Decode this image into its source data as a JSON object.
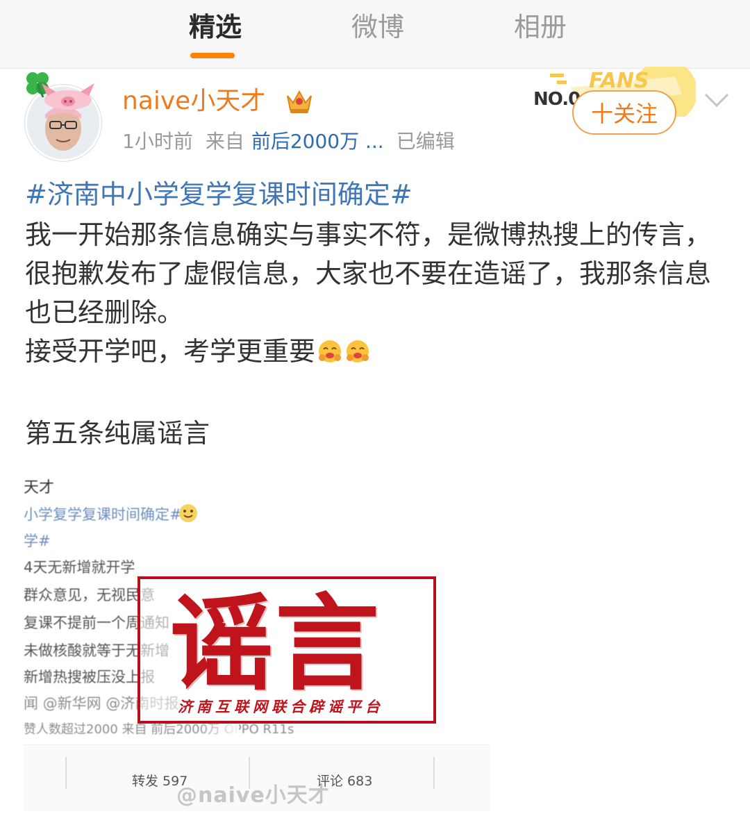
{
  "tabs": [
    {
      "label": "精选",
      "active": true
    },
    {
      "label": "微博",
      "active": false
    },
    {
      "label": "相册",
      "active": false
    }
  ],
  "colors": {
    "accent": "#ff8200",
    "username": "#f07a1a",
    "link": "#3f76b8",
    "stamp": "#c0141c"
  },
  "post": {
    "username": "naive小天才",
    "time": "1小时前",
    "from_prefix": "来自",
    "source": "前后2000万 ...",
    "edited": "已编辑",
    "fans_badge_text": "FANS",
    "fans_rank": "NO.0",
    "follow_label": "十关注",
    "hashtag": "#济南中小学复学复课时间确定#",
    "body_line1": "我一开始那条信息确实与事实不符，是微博热搜上的传言，很抱歉发布了虚假信息，大家也不要在造谣了，我那条信息也已经删除。",
    "body_line2": "接受开学吧，考学更重要",
    "body_line3": "第五条纯属谣言"
  },
  "embedded_screenshot": {
    "lines": [
      "天才",
      "小学复学复课时间确定#",
      "学#",
      "4天无新增就开学",
      "群众意见，无视民意",
      "复课不提前一个周通知",
      "未做核酸就等于无新增",
      "新增热搜被压没上报",
      "闻 @新华网 @济南时报",
      "赞人数超过2000  来自 前后2000万 OPPO R11s"
    ],
    "repost_label": "转发 597",
    "comment_label": "评论 683",
    "watermark": "@naive小天才",
    "stamp_text": "谣言",
    "stamp_subtitle": "济南互联网联合辟谣平台"
  }
}
